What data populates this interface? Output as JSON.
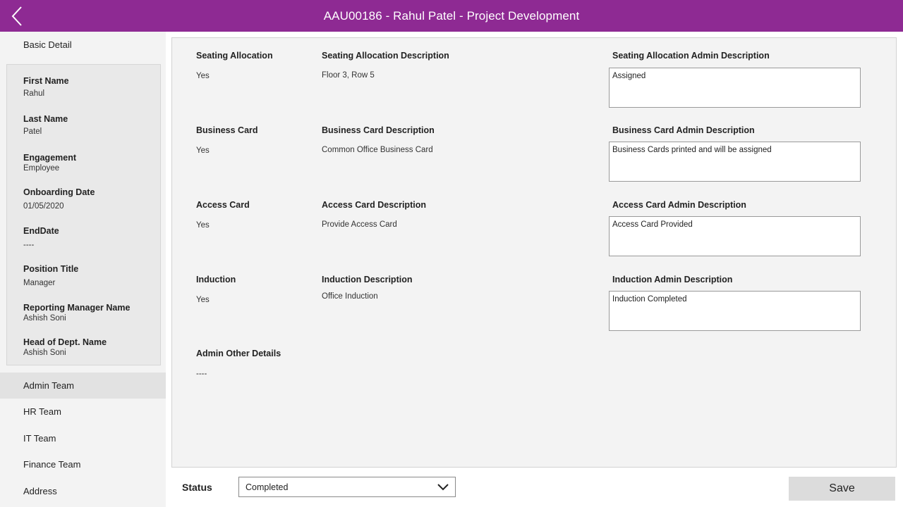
{
  "header": {
    "title": "AAU00186 - Rahul Patel - Project Development",
    "bg_color": "#8e2a93",
    "back_icon": "chevron-left-icon"
  },
  "sidebar": {
    "basic_detail_label": "Basic Detail",
    "fields": [
      {
        "label": "First Name",
        "value": "Rahul"
      },
      {
        "label": "Last Name",
        "value": "Patel"
      },
      {
        "label": "Engagement",
        "value": "Employee"
      },
      {
        "label": "Onboarding Date",
        "value": "01/05/2020"
      },
      {
        "label": "EndDate",
        "value": "----"
      },
      {
        "label": "Position Title",
        "value": "Manager"
      },
      {
        "label": "Reporting Manager Name",
        "value": "Ashish Soni"
      },
      {
        "label": "Head of Dept. Name",
        "value": "Ashish Soni"
      }
    ],
    "sections": [
      {
        "label": "Admin Team",
        "active": true
      },
      {
        "label": "HR Team",
        "active": false
      },
      {
        "label": "IT Team",
        "active": false
      },
      {
        "label": "Finance Team",
        "active": false
      },
      {
        "label": "Address",
        "active": false
      }
    ]
  },
  "main": {
    "rows": [
      {
        "item_label": "Seating Allocation",
        "item_value": "Yes",
        "desc_label": "Seating Allocation Description",
        "desc_value": "Floor 3, Row 5",
        "admin_label": "Seating Allocation Admin Description",
        "admin_value": "Assigned"
      },
      {
        "item_label": "Business Card",
        "item_value": "Yes",
        "desc_label": "Business Card Description",
        "desc_value": "Common Office Business Card",
        "admin_label": "Business Card Admin Description",
        "admin_value": "Business Cards printed and will be assigned"
      },
      {
        "item_label": "Access Card",
        "item_value": "Yes",
        "desc_label": "Access Card Description",
        "desc_value": "Provide Access Card",
        "admin_label": "Access Card Admin Description",
        "admin_value": "Access Card Provided"
      },
      {
        "item_label": "Induction",
        "item_value": "Yes",
        "desc_label": "Induction Description",
        "desc_value": "Office Induction",
        "admin_label": "Induction Admin Description",
        "admin_value": "Induction Completed"
      }
    ],
    "other": {
      "label": "Admin Other Details",
      "value": "----"
    }
  },
  "footer": {
    "status_label": "Status",
    "status_value": "Completed",
    "save_label": "Save"
  }
}
